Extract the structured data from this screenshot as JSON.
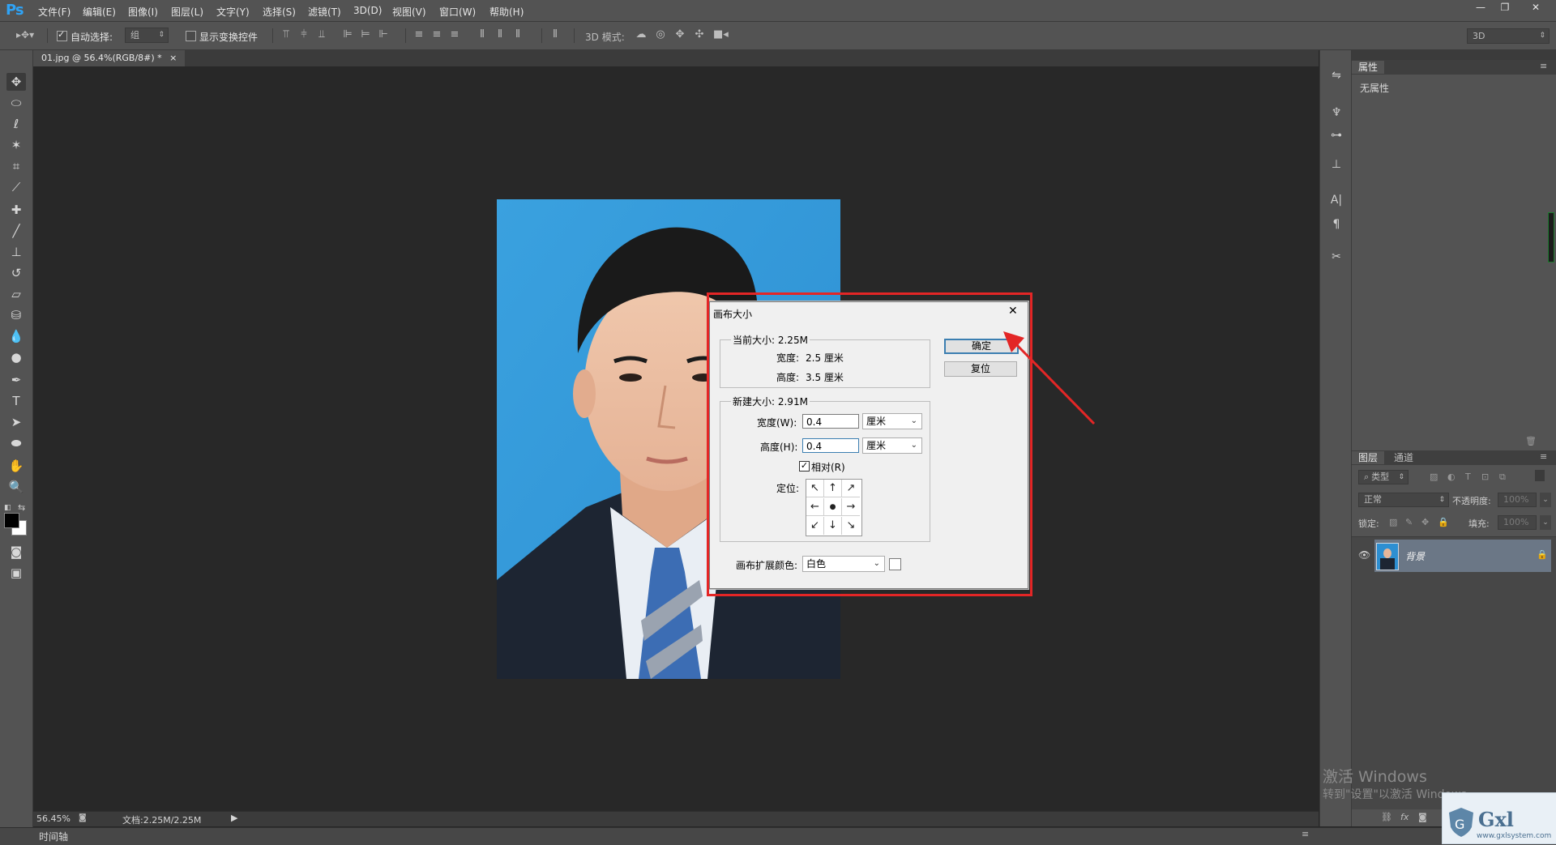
{
  "app": {
    "logo": "Ps",
    "menu": [
      "文件(F)",
      "编辑(E)",
      "图像(I)",
      "图层(L)",
      "文字(Y)",
      "选择(S)",
      "滤镜(T)",
      "3D(D)",
      "视图(V)",
      "窗口(W)",
      "帮助(H)"
    ],
    "window_buttons": [
      "—",
      "❐",
      "✕"
    ]
  },
  "options_bar": {
    "auto_select_label": "自动选择:",
    "auto_select_checked": true,
    "auto_select_value": "组",
    "show_transform_label": "显示变换控件",
    "show_transform_checked": false,
    "mode_3d_label": "3D 模式:",
    "workspace_value": "3D"
  },
  "document": {
    "tab_title": "01.jpg @ 56.4%(RGB/8#) *",
    "tab_close": "×"
  },
  "status": {
    "zoom": "56.45%",
    "doc_info": "文档:2.25M/2.25M",
    "timeline_label": "时间轴"
  },
  "properties_panel": {
    "tab": "属性",
    "empty_text": "无属性"
  },
  "layers_panel": {
    "tabs": [
      "图层",
      "通道"
    ],
    "filter_kind": "类型",
    "blend_mode": "正常",
    "opacity_label": "不透明度:",
    "opacity_value": "100%",
    "lock_label": "锁定:",
    "fill_label": "填充:",
    "fill_value": "100%",
    "layers": [
      {
        "name": "背景",
        "visible": true,
        "locked": true
      }
    ]
  },
  "dialog": {
    "title": "画布大小",
    "close": "✕",
    "current_size_label": "当前大小: 2.25M",
    "current_width_label": "宽度:",
    "current_width_value": "2.5 厘米",
    "current_height_label": "高度:",
    "current_height_value": "3.5 厘米",
    "new_size_label": "新建大小: 2.91M",
    "width_label": "宽度(W):",
    "width_value": "0.4",
    "width_unit": "厘米",
    "height_label": "高度(H):",
    "height_value": "0.4",
    "height_unit": "厘米",
    "relative_label": "相对(R)",
    "relative_checked": true,
    "anchor_label": "定位:",
    "anchor_arrows": [
      "↖",
      "↑",
      "↗",
      "←",
      "●",
      "→",
      "↙",
      "↓",
      "↘"
    ],
    "extension_color_label": "画布扩展颜色:",
    "extension_color_value": "白色",
    "ok_button": "确定",
    "reset_button": "复位"
  },
  "watermark": {
    "line1": "激活 Windows",
    "line2": "转到\"设置\"以激活 Windows。",
    "site_logo": "Gxl",
    "site_url": "www.gxlsystem.com"
  },
  "colors": {
    "accent": "#2fa3f6",
    "annotation_red": "#e32626",
    "photo_background": "#49a9e1"
  }
}
